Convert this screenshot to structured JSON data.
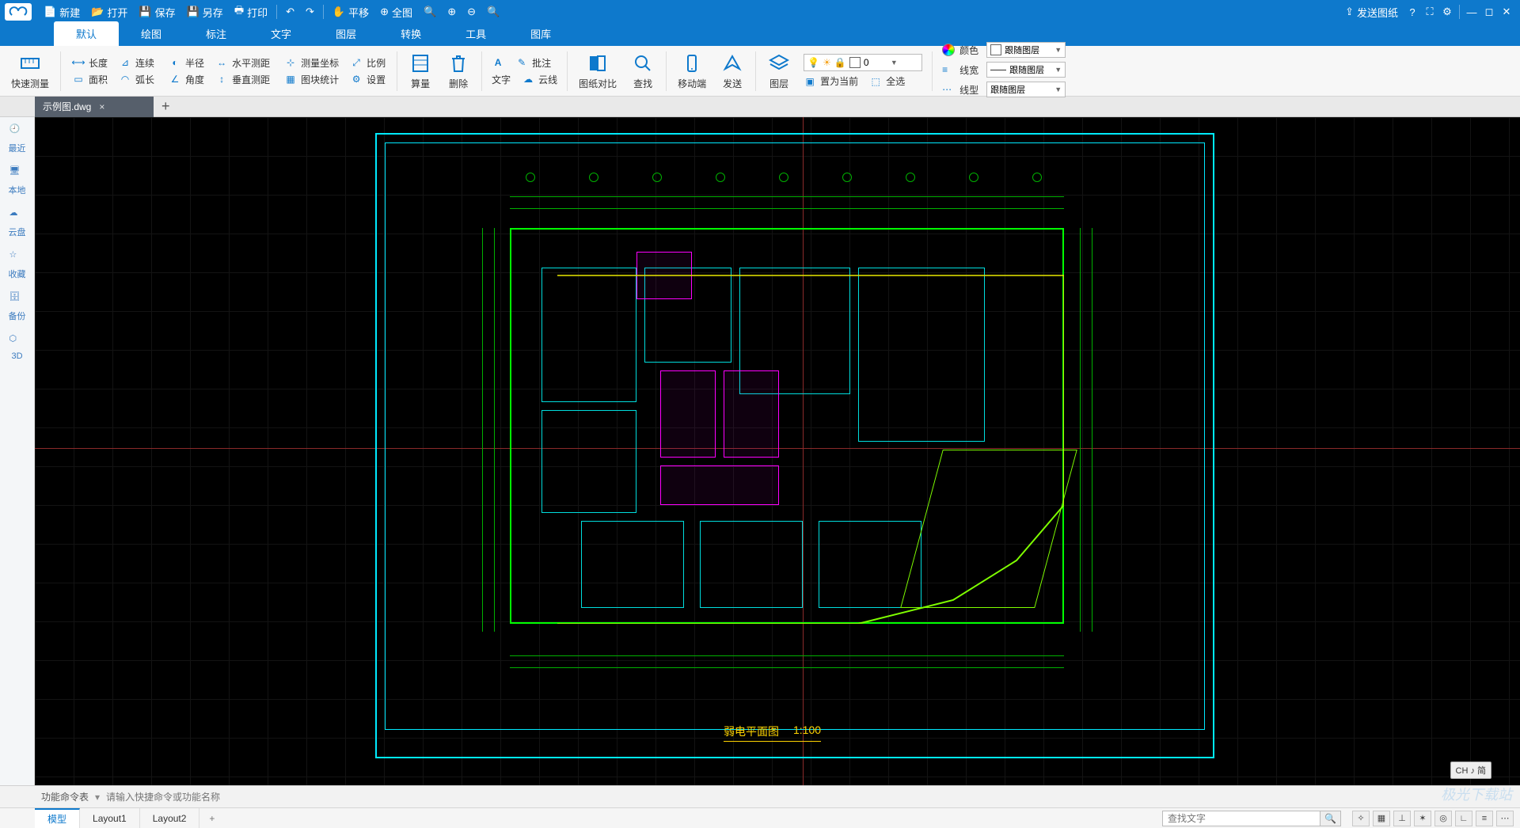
{
  "titlebar": {
    "new": "新建",
    "open": "打开",
    "save": "保存",
    "saveas": "另存",
    "print": "打印",
    "pan": "平移",
    "fullview": "全图",
    "send_drawing": "发送图纸"
  },
  "ribbon_tabs": [
    "默认",
    "绘图",
    "标注",
    "文字",
    "图层",
    "转换",
    "工具",
    "图库"
  ],
  "ribbon": {
    "quick_measure": "快速测量",
    "length": "长度",
    "continuous": "连续",
    "radius": "半径",
    "hdist": "水平测距",
    "area": "面积",
    "arc": "弧长",
    "angle": "角度",
    "vdist": "垂直测距",
    "coord": "测量坐标",
    "scale": "比例",
    "block_stat": "图块统计",
    "settings": "设置",
    "calc": "算量",
    "delete": "删除",
    "text": "文字",
    "annotate": "批注",
    "cloud": "云线",
    "compare": "图纸对比",
    "find": "查找",
    "mobile": "移动端",
    "send": "发送",
    "layers": "图层",
    "set_current": "置为当前",
    "select_all": "全选",
    "color": "颜色",
    "lineweight": "线宽",
    "linetype": "线型",
    "bylayer": "跟随图层",
    "layer_value": "0"
  },
  "document": {
    "name": "示例图.dwg"
  },
  "sidebar": {
    "recent": "最近",
    "local": "本地",
    "cloud": "云盘",
    "fav": "收藏",
    "backup": "备份",
    "threed": "3D"
  },
  "drawing": {
    "title": "弱电平面图",
    "scale": "1:100"
  },
  "ime": "CH ♪ 简",
  "command": {
    "label": "功能命令表",
    "placeholder": "请输入快捷命令或功能名称"
  },
  "layouts": {
    "model": "模型",
    "tabs": [
      "Layout1",
      "Layout2"
    ]
  },
  "search": {
    "placeholder": "查找文字"
  },
  "watermark": "极光下载站"
}
